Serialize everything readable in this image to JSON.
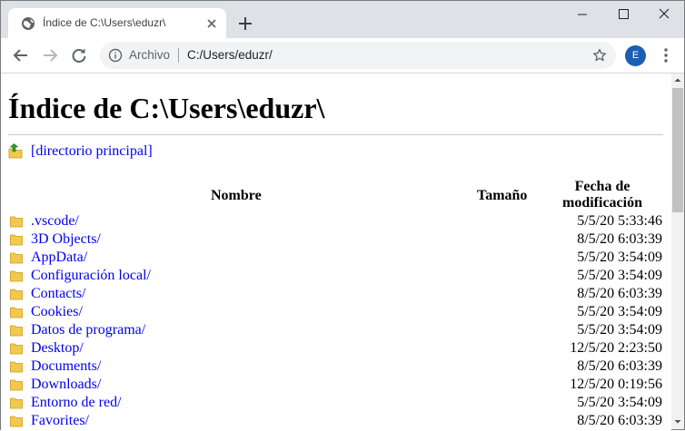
{
  "tab": {
    "title": "Índice de C:\\Users\\eduzr\\"
  },
  "omnibox": {
    "chip": "Archivo",
    "url": "C:/Users/eduzr/"
  },
  "profile": {
    "initial": "E"
  },
  "page": {
    "title": "Índice de C:\\Users\\eduzr\\",
    "parent_link": "[directorio principal]",
    "headers": {
      "name": "Nombre",
      "size": "Tamaño",
      "date_line1": "Fecha de",
      "date_line2": "modificación"
    },
    "rows": [
      {
        "name": ".vscode/",
        "date": "5/5/20 5:33:46"
      },
      {
        "name": "3D Objects/",
        "date": "8/5/20 6:03:39"
      },
      {
        "name": "AppData/",
        "date": "5/5/20 3:54:09"
      },
      {
        "name": "Configuración local/",
        "date": "5/5/20 3:54:09"
      },
      {
        "name": "Contacts/",
        "date": "8/5/20 6:03:39"
      },
      {
        "name": "Cookies/",
        "date": "5/5/20 3:54:09"
      },
      {
        "name": "Datos de programa/",
        "date": "5/5/20 3:54:09"
      },
      {
        "name": "Desktop/",
        "date": "12/5/20 2:23:50"
      },
      {
        "name": "Documents/",
        "date": "8/5/20 6:03:39"
      },
      {
        "name": "Downloads/",
        "date": "12/5/20 0:19:56"
      },
      {
        "name": "Entorno de red/",
        "date": "5/5/20 3:54:09"
      },
      {
        "name": "Favorites/",
        "date": "8/5/20 6:03:39"
      }
    ]
  },
  "colors": {
    "link": "#0000ee",
    "tabstrip": "#dee1e6",
    "avatar": "#1a5fb4",
    "folder": "#f2c94c"
  },
  "icons": {
    "favicon": "globe-icon",
    "tab_close": "close-icon",
    "new_tab": "plus-icon",
    "back": "back-arrow-icon",
    "forward": "forward-arrow-icon",
    "reload": "reload-icon",
    "info": "info-icon",
    "bookmark": "star-icon",
    "menu": "kebab-menu-icon",
    "parent": "parent-directory-icon",
    "folder": "folder-icon"
  }
}
